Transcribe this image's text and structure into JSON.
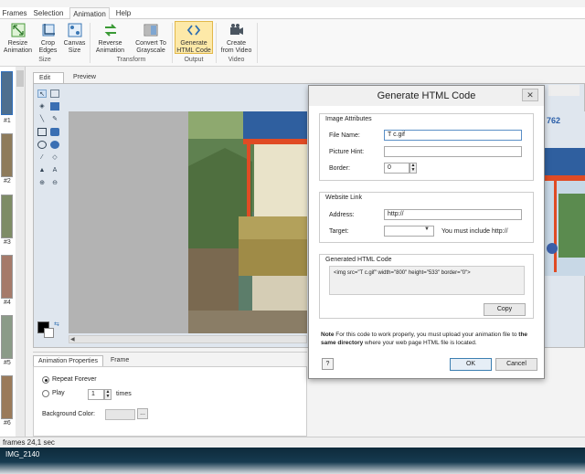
{
  "app": {
    "menu_tabs": [
      "Frames",
      "Selection",
      "Animation",
      "Help"
    ],
    "ribbon": {
      "buttons": [
        {
          "line1": "Resize",
          "line2": "Animation"
        },
        {
          "line1": "Crop",
          "line2": "Edges"
        },
        {
          "line1": "Canvas",
          "line2": "Size"
        },
        {
          "line1": "Reverse",
          "line2": "Animation"
        },
        {
          "line1": "Convert To",
          "line2": "Grayscale"
        },
        {
          "line1": "Generate",
          "line2": "HTML Code"
        },
        {
          "line1": "Create",
          "line2": "from Video"
        }
      ],
      "groups": [
        "Size",
        "Transform",
        "Output",
        "Video"
      ]
    },
    "frame_numbers": [
      "#1",
      "#2",
      "#3",
      "#4",
      "#5",
      "#6"
    ],
    "edit_tabs": [
      "Edit",
      "Preview"
    ],
    "bottom_tabs": [
      "Animation Properties",
      "Frame Properties"
    ],
    "animation_props": {
      "repeat_forever": "Repeat Forever",
      "play": "Play",
      "play_count": "1",
      "times": "times",
      "background_color_label": "Background Color:",
      "browse": "..."
    },
    "background_text": "762",
    "statusbar": "frames 24,1 sec",
    "taskbar_title": "IMG_2140"
  },
  "dialog": {
    "title": "Generate HTML Code",
    "close": "✕",
    "image_attributes": {
      "group_label": "Image Attributes",
      "file_name_label": "File Name:",
      "file_name_value": "T           c.gif",
      "picture_hint_label": "Picture Hint:",
      "picture_hint_value": "",
      "border_label": "Border:",
      "border_value": "0"
    },
    "website_link": {
      "group_label": "Website Link",
      "address_label": "Address:",
      "address_value": "http://",
      "target_label": "Target:",
      "target_value": "",
      "hint": "You must include http://"
    },
    "generated": {
      "group_label": "Generated HTML Code",
      "code": "<img src=\"T           c.gif\" width=\"800\" height=\"533\" border=\"0\">",
      "copy": "Copy"
    },
    "note_prefix": "Note",
    "note_text": " For this code to work properly, you must upload your animation file to ",
    "note_bold": "the same directory",
    "note_suffix": " where your web page HTML file is located.",
    "help": "?",
    "ok": "OK",
    "cancel": "Cancel"
  },
  "colors": {
    "accent_selected": "#fde9a8",
    "dialog_border": "#8a8a8a",
    "default_button": "#3c7fb1"
  }
}
